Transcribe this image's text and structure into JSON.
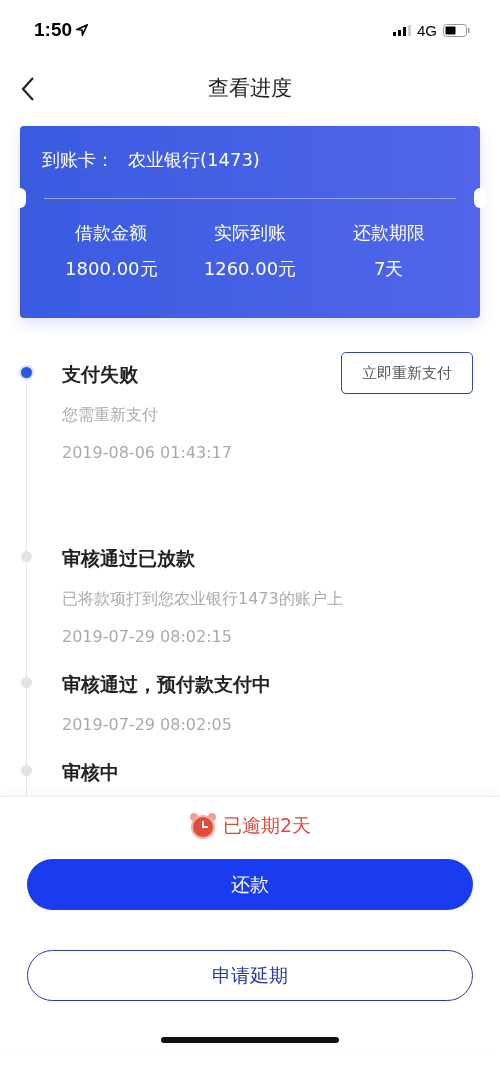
{
  "status_bar": {
    "time": "1:50",
    "network": "4G"
  },
  "nav": {
    "title": "查看进度"
  },
  "card": {
    "account_label": "到账卡：",
    "account_value": "农业银行(1473)",
    "stats": [
      {
        "label": "借款金额",
        "value": "1800.00元"
      },
      {
        "label": "实际到账",
        "value": "1260.00元"
      },
      {
        "label": "还款期限",
        "value": "7天"
      }
    ]
  },
  "timeline": [
    {
      "title": "支付失败",
      "active": true,
      "desc": "您需重新支付",
      "time": "2019-08-06 01:43:17",
      "action": "立即重新支付"
    },
    {
      "title": "审核通过已放款",
      "active": false,
      "desc": "已将款项打到您农业银行1473的账户上",
      "time": "2019-07-29 08:02:15"
    },
    {
      "title": "审核通过，预付款支付中",
      "active": false,
      "time": "2019-07-29 08:02:05"
    },
    {
      "title": "审核中",
      "active": false
    }
  ],
  "overdue": "已逾期2天",
  "buttons": [
    {
      "label": "还款",
      "kind": "primary"
    },
    {
      "label": "申请延期",
      "kind": "outline"
    }
  ]
}
